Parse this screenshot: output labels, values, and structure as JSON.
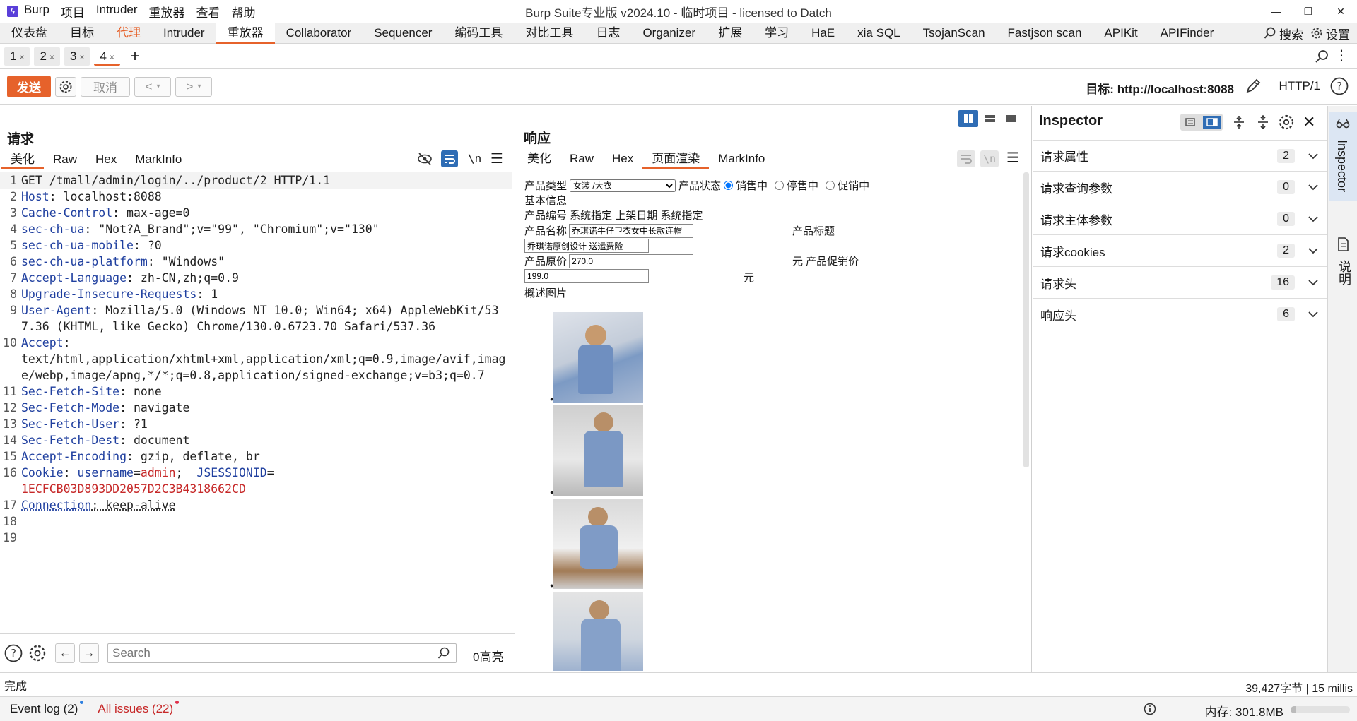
{
  "titlebar": {
    "app_icon": "burp-logo-icon",
    "menu": [
      "Burp",
      "项目",
      "Intruder",
      "重放器",
      "查看",
      "帮助"
    ],
    "title": "Burp Suite专业版  v2024.10 - 临时项目 - licensed to Datch"
  },
  "main_tabs": [
    "仪表盘",
    "目标",
    "代理",
    "Intruder",
    "重放器",
    "Collaborator",
    "Sequencer",
    "编码工具",
    "对比工具",
    "日志",
    "Organizer",
    "扩展",
    "学习",
    "HaE",
    "xia SQL",
    "TsojanScan",
    "Fastjson scan",
    "APIKit",
    "APIFinder"
  ],
  "main_tabs_right": {
    "search": "搜索",
    "settings": "设置"
  },
  "sub_tabs": [
    {
      "label": "1"
    },
    {
      "label": "2"
    },
    {
      "label": "3"
    },
    {
      "label": "4"
    }
  ],
  "toolbar": {
    "send": "发送",
    "cancel": "取消",
    "target_label": "目标: http://localhost:8088",
    "http_version": "HTTP/1"
  },
  "request": {
    "title": "请求",
    "tabs": [
      "美化",
      "Raw",
      "Hex",
      "MarkInfo"
    ],
    "newline_label": "\\n",
    "lines": [
      {
        "n": "1",
        "key": "",
        "sep": "",
        "val": "GET /tmall/admin/login/../product/2 HTTP/1.1"
      },
      {
        "n": "2",
        "key": "Host",
        "sep": ": ",
        "val": "localhost:8088"
      },
      {
        "n": "3",
        "key": "Cache-Control",
        "sep": ": ",
        "val": "max-age=0"
      },
      {
        "n": "4",
        "key": "sec-ch-ua",
        "sep": ": ",
        "val": "\"Not?A_Brand\";v=\"99\", \"Chromium\";v=\"130\""
      },
      {
        "n": "5",
        "key": "sec-ch-ua-mobile",
        "sep": ": ",
        "val": "?0"
      },
      {
        "n": "6",
        "key": "sec-ch-ua-platform",
        "sep": ": ",
        "val": "\"Windows\""
      },
      {
        "n": "7",
        "key": "Accept-Language",
        "sep": ": ",
        "val": "zh-CN,zh;q=0.9"
      },
      {
        "n": "8",
        "key": "Upgrade-Insecure-Requests",
        "sep": ": ",
        "val": "1"
      },
      {
        "n": "9",
        "key": "User-Agent",
        "sep": ": ",
        "val": "Mozilla/5.0 (Windows NT 10.0; Win64; x64) AppleWebKit/537.36 (KHTML, like Gecko) Chrome/130.0.6723.70 Safari/537.36"
      },
      {
        "n": "10",
        "key": "Accept",
        "sep": ":\n",
        "val": "text/html,application/xhtml+xml,application/xml;q=0.9,image/avif,image/webp,image/apng,*/*;q=0.8,application/signed-exchange;v=b3;q=0.7"
      },
      {
        "n": "11",
        "key": "Sec-Fetch-Site",
        "sep": ": ",
        "val": "none"
      },
      {
        "n": "12",
        "key": "Sec-Fetch-Mode",
        "sep": ": ",
        "val": "navigate"
      },
      {
        "n": "13",
        "key": "Sec-Fetch-User",
        "sep": ": ",
        "val": "?1"
      },
      {
        "n": "14",
        "key": "Sec-Fetch-Dest",
        "sep": ": ",
        "val": "document"
      },
      {
        "n": "15",
        "key": "Accept-Encoding",
        "sep": ": ",
        "val": "gzip, deflate, br"
      },
      {
        "n": "16",
        "key": "Cookie",
        "sep": ": ",
        "val": ""
      },
      {
        "n": "17",
        "key": "Connection",
        "sep": ": ",
        "val": "keep-alive"
      },
      {
        "n": "18",
        "key": "",
        "sep": "",
        "val": ""
      },
      {
        "n": "19",
        "key": "",
        "sep": "",
        "val": ""
      }
    ],
    "cookie": {
      "k1": "username",
      "v1": "admin",
      "k2": "JSESSIONID",
      "v2": "1ECFCB03D893DD2057D2C3B4318662CD"
    },
    "search_placeholder": "Search",
    "highlight_count": "0高亮"
  },
  "response": {
    "title": "响应",
    "tabs": [
      "美化",
      "Raw",
      "Hex",
      "页面渲染",
      "MarkInfo"
    ],
    "newline_label": "\\n",
    "render": {
      "type_label": "产品类型",
      "type_value": "女装 /大衣",
      "status_label": "产品状态",
      "status_options": [
        "销售中",
        "停售中",
        "促销中"
      ],
      "basic_info": "基本信息",
      "code_line": "产品编号 系统指定 上架日期 系统指定",
      "name_label": "产品名称",
      "name_value": "乔琪诺牛仔卫衣女中长款连帽",
      "title_label": "产品标题",
      "subtitle_value": "乔琪诺原创设计 送运费险",
      "orig_price_label": "产品原价",
      "orig_price_value": "270.0",
      "yuan_promo": "元 产品促销价",
      "promo_price_value": "199.0",
      "yuan": "元",
      "desc_images": "概述图片"
    }
  },
  "inspector": {
    "title": "Inspector",
    "rows": [
      {
        "label": "请求属性",
        "count": "2"
      },
      {
        "label": "请求查询参数",
        "count": "0"
      },
      {
        "label": "请求主体参数",
        "count": "0"
      },
      {
        "label": "请求cookies",
        "count": "2"
      },
      {
        "label": "请求头",
        "count": "16"
      },
      {
        "label": "响应头",
        "count": "6"
      }
    ],
    "side_tabs": [
      "Inspector",
      "说明"
    ]
  },
  "status": {
    "left": "完成",
    "right": "39,427字节 | 15 millis"
  },
  "bottom": {
    "event_log": "Event log (2)",
    "all_issues": "All issues (22)",
    "memory": "内存: 301.8MB"
  },
  "colors": {
    "accent": "#e6622b",
    "header_key": "#1f3f9f",
    "cookie_value": "#c62828",
    "layout_blue": "#2f6db5"
  }
}
